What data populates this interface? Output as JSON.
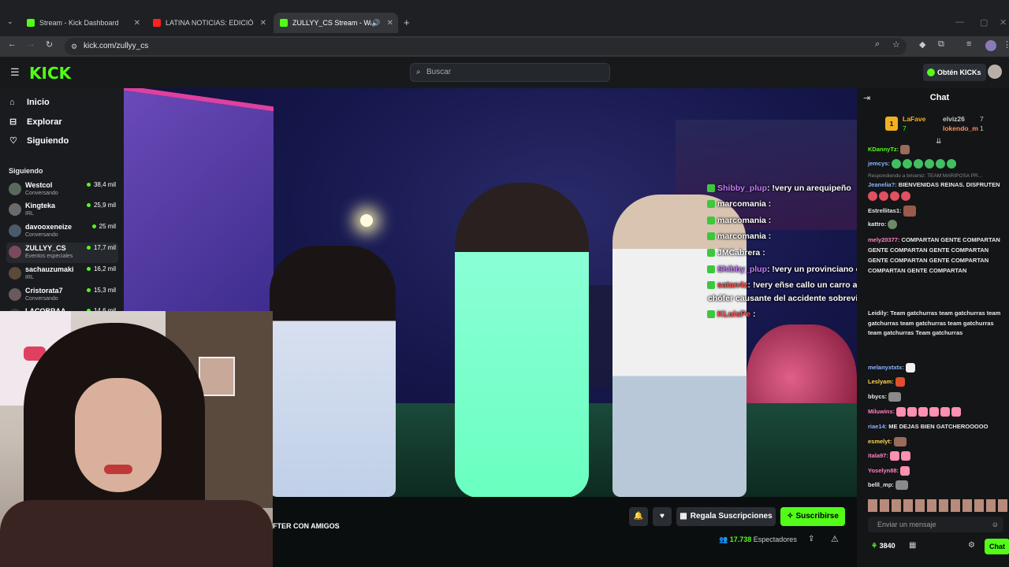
{
  "browser": {
    "tabs": [
      {
        "label": "Stream - Kick Dashboard",
        "favicon_color": "#53fc18"
      },
      {
        "label": "LATINA NOTICIAS: EDICIÓN CE",
        "favicon_color": "#ff2020"
      },
      {
        "label": "ZULLYY_CS Stream - Watch",
        "favicon_color": "#53fc18"
      }
    ],
    "url": "kick.com/zullyy_cs"
  },
  "header": {
    "logo": "KICK",
    "search_placeholder": "Buscar",
    "get_kicks": "Obtén KICKs"
  },
  "sidebar": {
    "nav": [
      {
        "label": "Inicio",
        "icon": "home-icon"
      },
      {
        "label": "Explorar",
        "icon": "compass-icon"
      },
      {
        "label": "Siguiendo",
        "icon": "heart-icon"
      }
    ],
    "following_title": "Siguiendo",
    "following": [
      {
        "name": "Westcol",
        "category": "Conversando",
        "viewers": "38,4 mil",
        "color": "#5a6a5a"
      },
      {
        "name": "Kingteka",
        "category": "IRL",
        "viewers": "25,9 mil",
        "color": "#6b6b6b"
      },
      {
        "name": "davooxeneize",
        "category": "Conversando",
        "viewers": "25 mil",
        "color": "#4a5a6a"
      },
      {
        "name": "ZULLYY_CS",
        "category": "Eventos especiales",
        "viewers": "17,7 mil",
        "color": "#7a4a5a"
      },
      {
        "name": "sachauzumaki",
        "category": "IRL",
        "viewers": "16,2 mil",
        "color": "#5a4a3a"
      },
      {
        "name": "Cristorata7",
        "category": "Conversando",
        "viewers": "15,3 mil",
        "color": "#6a5a5a"
      },
      {
        "name": "LACOBRAA",
        "category": "",
        "viewers": "14,6 mil",
        "color": "#3a3a3a"
      }
    ]
  },
  "stream": {
    "overlay_chat": [
      {
        "user": "Shibby_plup",
        "text": ": !very un arequipeño",
        "color": "#c77dff"
      },
      {
        "user": "marcomania",
        "text": ":",
        "color": "#ffffff"
      },
      {
        "user": "marcomania",
        "text": ":",
        "color": "#ffffff"
      },
      {
        "user": "marcomania",
        "text": ":",
        "color": "#ffffff"
      },
      {
        "user": "JMCabrera",
        "text": ":",
        "color": "#ffffff"
      },
      {
        "user": "Shibby_plup",
        "text": ": !very un provinciano osea a nadie le importa mano",
        "color": "#c77dff"
      },
      {
        "user": "satan4z",
        "text": ": !very eñse callo un carro a un barranco y encima el",
        "color": "#ff4d4d"
      },
      {
        "user": "",
        "text": "chófer causante del accidente sobrevivió",
        "color": "#ffffff"
      },
      {
        "user": "KLuisPe",
        "text": ":",
        "color": "#ff4d4d"
      }
    ],
    "title_fragment": "FTER CON AMIGOS",
    "gift_subs": "Regala Suscripciones",
    "subscribe": "Suscribirse",
    "viewers": "17.738",
    "viewers_label": "Espectadores"
  },
  "chat": {
    "title": "Chat",
    "leaderboard": [
      {
        "rank": "1",
        "name": "LaFave",
        "count": "7"
      },
      {
        "name": "elviz26",
        "count": "7"
      },
      {
        "name": "lokendo_m",
        "count": "1"
      }
    ],
    "messages": [
      {
        "user": "KDannyTz:",
        "text": "",
        "color": "#53fc18"
      },
      {
        "user": "jemcys:",
        "text": "",
        "color": "#8ab4ff"
      },
      {
        "user": "Respondiendo a briseniz:",
        "text": "TEAM MARIPOSA PR...",
        "color": "#888888"
      },
      {
        "user": "Jeanelia?:",
        "text": "BIENVENIDAS REINAS. DISFRUTEN",
        "color": "#8ab4ff"
      },
      {
        "user": "",
        "text": "",
        "color": "#ffffff"
      },
      {
        "user": "Estrellitas1:",
        "text": "",
        "color": "#e6e6e6"
      },
      {
        "user": "kattro:",
        "text": "",
        "color": "#e6e6e6"
      },
      {
        "user": "mely20377:",
        "text": "COMPARTAN GENTE COMPARTAN GENTE COMPARTAN GENTE COMPARTAN GENTE COMPARTAN GENTE COMPARTAN COMPARTAN GENTE COMPARTAN",
        "color": "#ff80c0"
      },
      {
        "user": "Leidily:",
        "text": "Team gatchurras team gatchurras team gatchurras team gatchurras team gatchurras team gatchurras Team gatchurras",
        "color": "#e6e6e6"
      },
      {
        "user": "melanyxtxtx:",
        "text": "",
        "color": "#8ab4ff"
      },
      {
        "user": "Leslyam:",
        "text": "",
        "color": "#ffd54d"
      },
      {
        "user": "bbycs:",
        "text": "",
        "color": "#e6e6e6"
      },
      {
        "user": "Miluwins:",
        "text": "",
        "color": "#ff80c0"
      },
      {
        "user": "riae14:",
        "text": "ME DEJAS BIEN GATCHEROOOOO",
        "color": "#8ab4ff"
      },
      {
        "user": "esmelyt:",
        "text": "",
        "color": "#ffd54d"
      },
      {
        "user": "itala97:",
        "text": "",
        "color": "#ff80c0"
      },
      {
        "user": "Yoselyn88:",
        "text": "",
        "color": "#ff80c0"
      },
      {
        "user": "belll_mp:",
        "text": "",
        "color": "#e6e6e6"
      }
    ],
    "input_placeholder": "Enviar un mensaje",
    "kicks_count": "3840",
    "send_label": "Chat"
  }
}
